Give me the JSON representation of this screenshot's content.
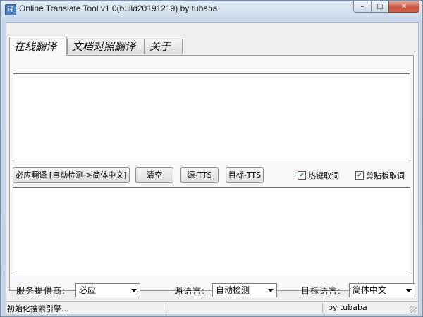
{
  "window": {
    "title": "Online Translate Tool v1.0(build20191219) by tubaba",
    "controls": {
      "minimize": "–",
      "maximize": "□",
      "close": "✕"
    }
  },
  "tabs": [
    {
      "label": "在线翻译",
      "active": true
    },
    {
      "label": "文档对照翻译",
      "active": false
    },
    {
      "label": "关于",
      "active": false
    }
  ],
  "source_text": "",
  "target_text": "",
  "buttons": {
    "translate": "必应翻译 [自动检测->简体中文]",
    "clear": "清空",
    "source_tts": "源-TTS",
    "target_tts": "目标-TTS"
  },
  "checkboxes": {
    "hotkey": {
      "label": "热键取词",
      "checked": true
    },
    "clipboard": {
      "label": "剪贴板取词",
      "checked": true
    }
  },
  "options": {
    "provider_label": "服务提供商:",
    "provider_value": "必应",
    "source_lang_label": "源语言:",
    "source_lang_value": "自动检测",
    "target_lang_label": "目标语言:",
    "target_lang_value": "简体中文"
  },
  "status": {
    "message": "初始化搜索引擎...",
    "author": "by tubaba"
  }
}
